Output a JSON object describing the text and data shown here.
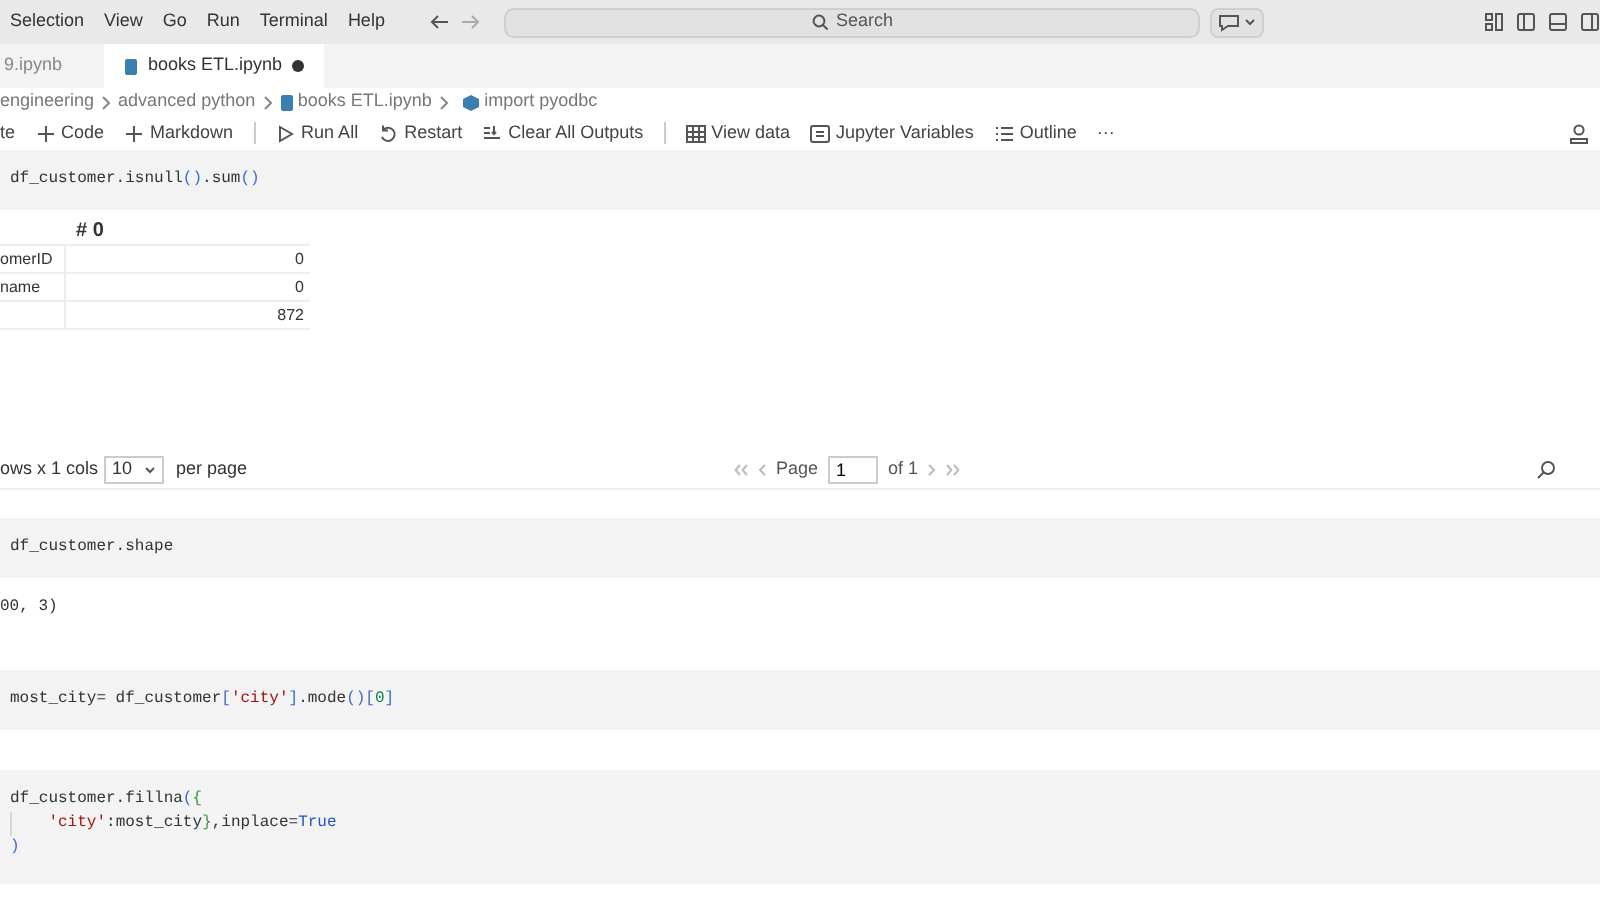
{
  "menu": [
    "Selection",
    "View",
    "Go",
    "Run",
    "Terminal",
    "Help"
  ],
  "search": {
    "placeholder": "Search"
  },
  "tabs": [
    {
      "label": "9.ipynb",
      "selected": false,
      "dirty": false
    },
    {
      "label": "books ETL.ipynb",
      "selected": true,
      "dirty": true
    }
  ],
  "breadcrumb": [
    {
      "label": "engineering",
      "kind": "folder"
    },
    {
      "label": "advanced python",
      "kind": "folder"
    },
    {
      "label": "books ETL.ipynb",
      "kind": "notebook"
    },
    {
      "label": "import pyodbc",
      "kind": "symbol"
    }
  ],
  "toolbar": [
    [
      {
        "label": "te",
        "kind": "text"
      },
      {
        "label": "Code",
        "kind": "plus"
      },
      {
        "label": "Markdown",
        "kind": "plus"
      }
    ],
    [
      {
        "label": "Run All",
        "kind": "run"
      },
      {
        "label": "Restart",
        "kind": "restart"
      },
      {
        "label": "Clear All Outputs",
        "kind": "clear"
      }
    ],
    [
      {
        "label": "View data",
        "kind": "grid"
      },
      {
        "label": "Jupyter Variables",
        "kind": "vars"
      },
      {
        "label": "Outline",
        "kind": "list"
      },
      {
        "label": "···",
        "kind": "text"
      }
    ]
  ],
  "cells": [
    {
      "code": [
        [
          {
            "text": "df_customer.isnull",
            "kind": "plain"
          },
          {
            "text": "()",
            "kind": "bracket"
          },
          {
            "text": ".sum",
            "kind": "plain"
          },
          {
            "text": "()",
            "kind": "bracket"
          }
        ]
      ],
      "output": {
        "kind": "dataframe",
        "header": "# 0",
        "rows": [
          {
            "index": "omerID",
            "value": "0"
          },
          {
            "index": "name",
            "value": "0"
          },
          {
            "value": "872"
          }
        ],
        "pager": {
          "summary": "ows x 1 cols",
          "page_size": "10",
          "per_page": "per page",
          "page_label": "Page",
          "page": "1",
          "of": "of 1"
        }
      }
    },
    {
      "code": [
        [
          {
            "text": "df_customer.shape",
            "kind": "plain"
          }
        ]
      ],
      "output": {
        "kind": "text",
        "text": "00, 3)"
      }
    },
    {
      "code": [
        [
          {
            "text": "most_city= df_customer",
            "kind": "plain"
          },
          {
            "text": "[",
            "kind": "bracket"
          },
          {
            "text": "'city'",
            "kind": "string"
          },
          {
            "text": "]",
            "kind": "bracket"
          },
          {
            "text": ".mode",
            "kind": "plain"
          },
          {
            "text": "()[",
            "kind": "bracket"
          },
          {
            "text": "0",
            "kind": "number"
          },
          {
            "text": "]",
            "kind": "bracket"
          }
        ]
      ]
    },
    {
      "code": [
        [
          {
            "text": "df_customer.fillna",
            "kind": "plain"
          },
          {
            "text": "(",
            "kind": "bracket"
          },
          {
            "text": "{",
            "kind": "brace"
          }
        ],
        [
          {
            "kind": "indent"
          },
          {
            "text": "'city'",
            "kind": "string"
          },
          {
            "text": ":most_city",
            "kind": "plain"
          },
          {
            "text": "}",
            "kind": "brace"
          },
          {
            "text": ",inplace=",
            "kind": "plain"
          },
          {
            "text": "True",
            "kind": "keyword"
          }
        ],
        [
          {
            "text": ")",
            "kind": "bracket"
          }
        ]
      ]
    }
  ]
}
